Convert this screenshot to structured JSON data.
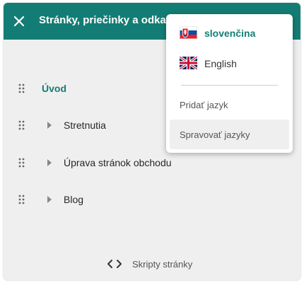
{
  "header": {
    "title": "Stránky, priečinky a odkazy",
    "background_color": "#137d75",
    "close_icon": "close-icon"
  },
  "nav": {
    "accent_color": "#137d75",
    "items": [
      {
        "label": "Úvod",
        "active": true,
        "expandable": false
      },
      {
        "label": "Stretnutia",
        "active": false,
        "expandable": true
      },
      {
        "label": "Úprava stránok obchodu",
        "active": false,
        "expandable": true
      },
      {
        "label": "Blog",
        "active": false,
        "expandable": true
      }
    ]
  },
  "footer": {
    "scripts_label": "Skripty stránky",
    "scripts_icon": "code-icon"
  },
  "language_menu": {
    "languages": [
      {
        "label": "slovenčina",
        "flag": "slovakia-flag-icon",
        "selected": true
      },
      {
        "label": "English",
        "flag": "uk-flag-icon",
        "selected": false
      }
    ],
    "add_language_label": "Pridať jazyk",
    "manage_languages_label": "Spravovať jazyky"
  }
}
